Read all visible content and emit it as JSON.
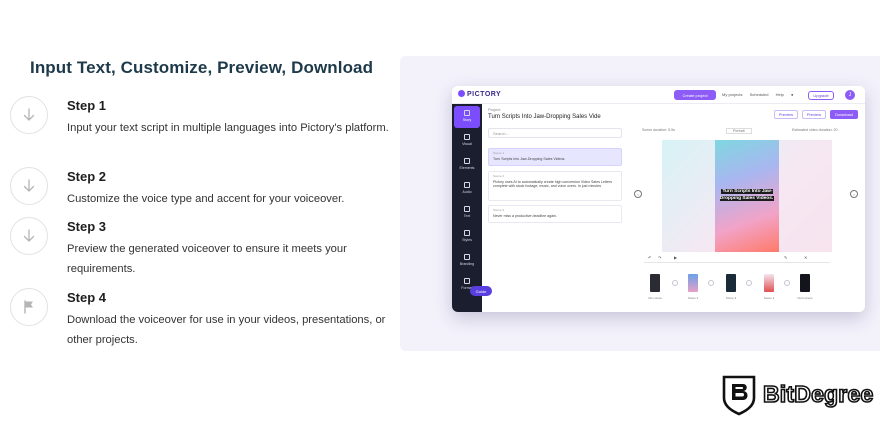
{
  "heading": "Input Text, Customize, Preview, Download",
  "steps": [
    {
      "title": "Step 1",
      "desc": "Input your text script in multiple languages into Pictory's platform.",
      "icon": "arrow-down-icon"
    },
    {
      "title": "Step 2",
      "desc": "Customize the voice type and accent for your voiceover.",
      "icon": "arrow-down-icon"
    },
    {
      "title": "Step 3",
      "desc": "Preview the generated voiceover to ensure it meets your requirements.",
      "icon": "arrow-down-icon"
    },
    {
      "title": "Step 4",
      "desc": "Download the voiceover for use in your videos, presentations, or other projects.",
      "icon": "flag-icon"
    }
  ],
  "app": {
    "logo": "PICTORY",
    "create_btn": "Create project",
    "nav": [
      "My projects",
      "Scheduled",
      "Help"
    ],
    "upgrade": "Upgrade",
    "avatar": "J",
    "project_label": "Project",
    "project_title": "Turn Scripts Into Jaw-Dropping Sales Vide",
    "buttons": {
      "preview1": "Preview",
      "preview2": "Preview",
      "download": "Download"
    },
    "sidebar": [
      "Story",
      "Visual",
      "Elements",
      "Audio",
      "Text",
      "Styles",
      "Branding",
      "Format"
    ],
    "guide": "Guide",
    "search_placeholder": "Search...",
    "scenes": [
      {
        "label": "Scene 1",
        "text": "Turn Scripts Into Jaw-Dropping Sales Videos."
      },
      {
        "label": "Scene 2",
        "text": "Pictory uses AI to automatically create high conversion Video Sales Letters complete with stock footage, music, and voice overs. In just minutes"
      },
      {
        "label": "Scene 3",
        "text": "Never miss a productive deadline again."
      }
    ],
    "preview": {
      "scene_duration": "Scene duration: 5.5s",
      "format": "Portrait",
      "video_duration": "Estimated video duration: 20",
      "caption": "Turn Scripts Into Jaw-Dropping Sales Videos."
    },
    "thumbs": [
      "Intro scene",
      "Scene 2",
      "Scene 3",
      "Scene 4",
      "Outro scene"
    ]
  },
  "brand": "BitDegree",
  "colors": {
    "accent": "#8d5cf6",
    "heading": "#1e3a4a",
    "panel": "#f3f2fb",
    "sidebar": "#1b1e2e"
  }
}
